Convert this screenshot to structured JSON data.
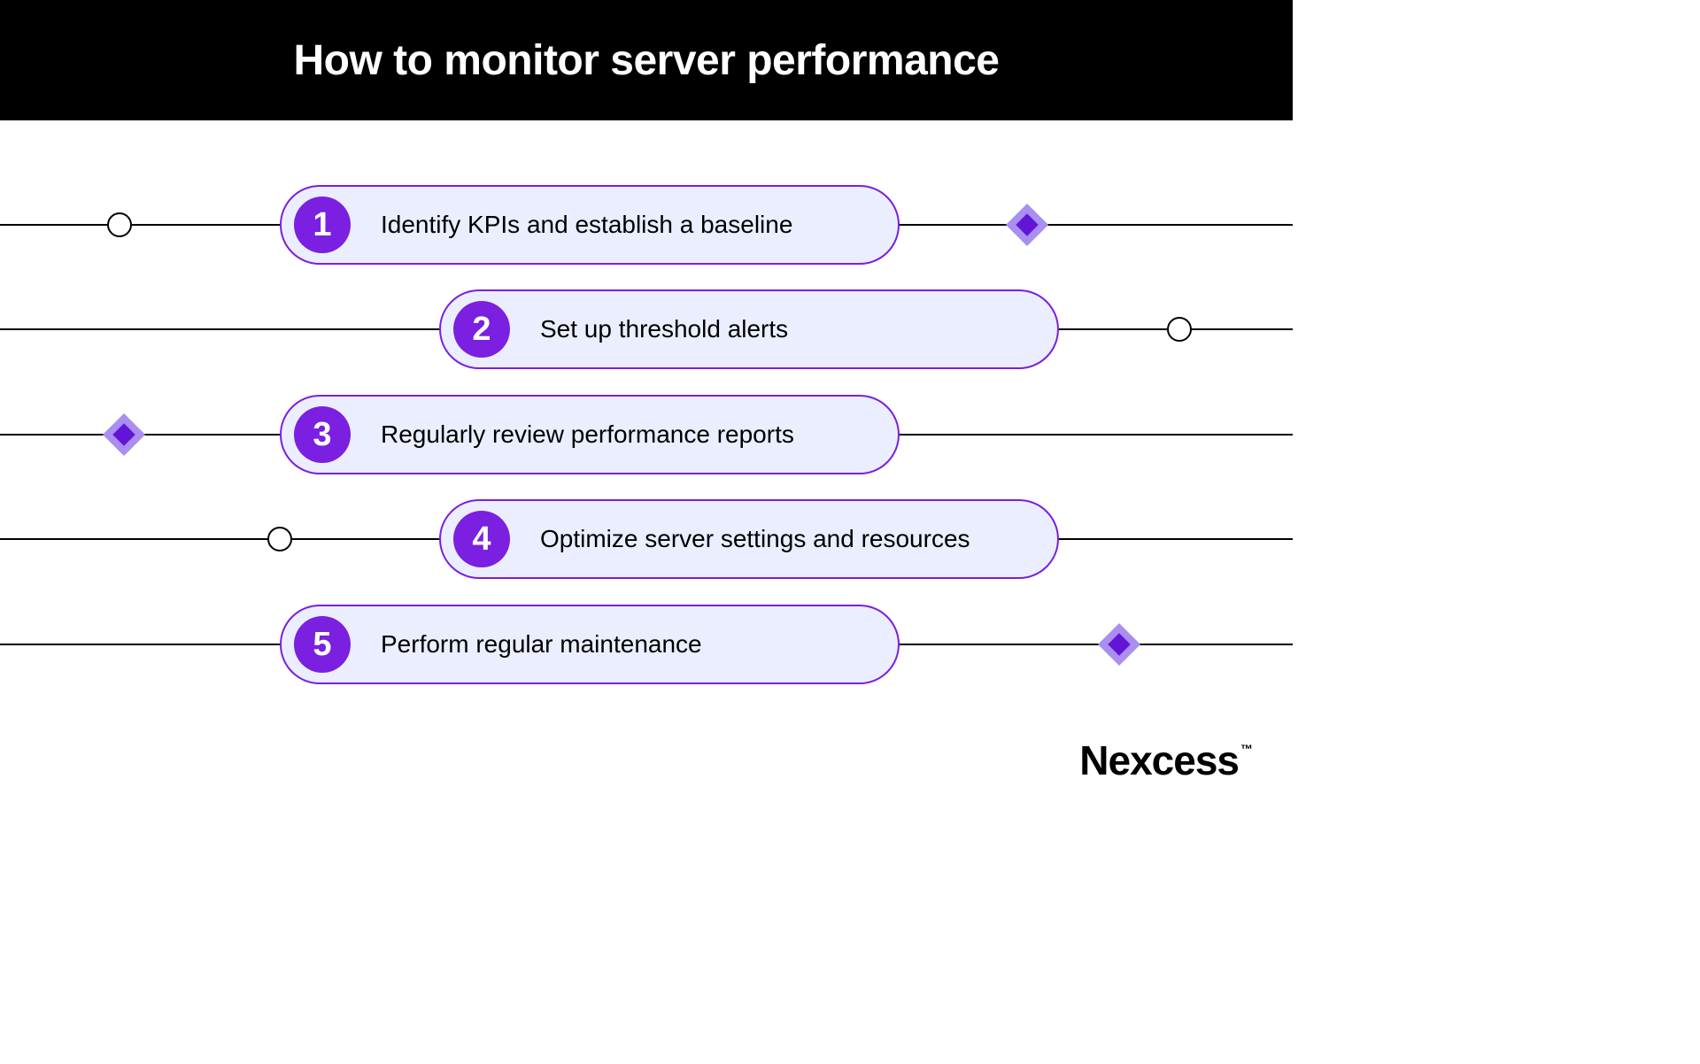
{
  "title": "How to monitor server performance",
  "brand": "Nexcess",
  "steps": [
    {
      "number": "1",
      "label": "Identify KPIs and establish a baseline"
    },
    {
      "number": "2",
      "label": "Set up threshold alerts"
    },
    {
      "number": "3",
      "label": "Regularly review performance reports"
    },
    {
      "number": "4",
      "label": "Optimize server settings and resources"
    },
    {
      "number": "5",
      "label": "Perform regular maintenance"
    }
  ]
}
